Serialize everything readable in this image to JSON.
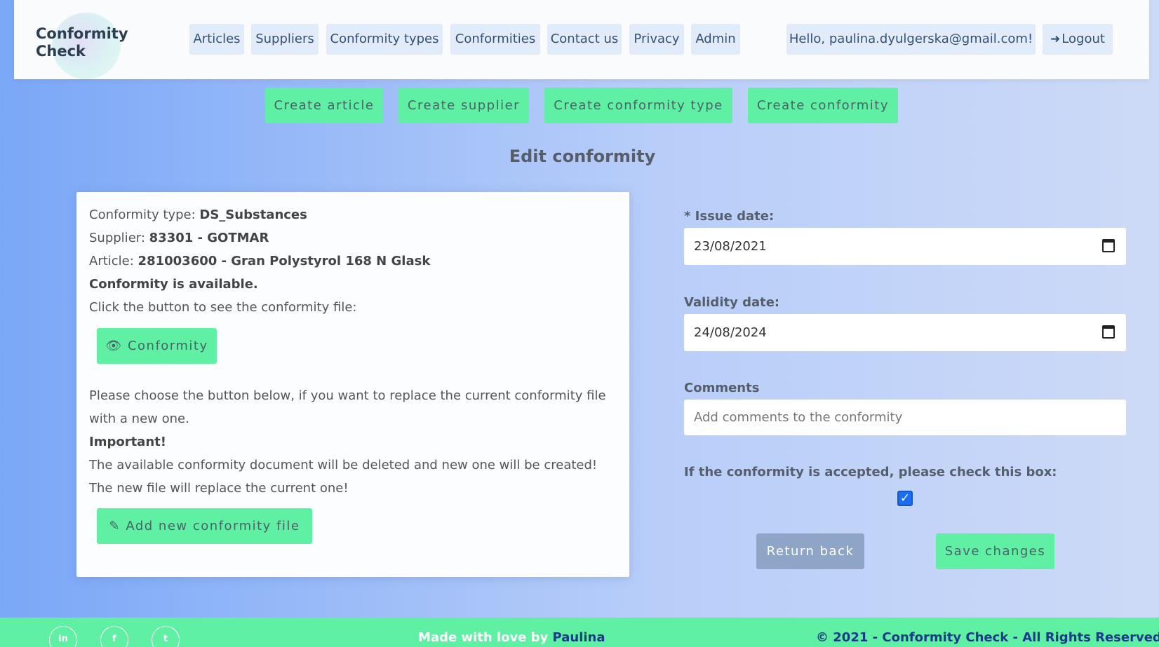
{
  "header": {
    "logo_line1": "Conformity",
    "logo_line2": "Check",
    "nav": [
      "Articles",
      "Suppliers",
      "Conformity types",
      "Conformities",
      "Contact us",
      "Privacy",
      "Admin"
    ],
    "greeting": "Hello, paulina.dyulgerska@gmail.com!",
    "logout_label": "Logout"
  },
  "create_buttons": [
    "Create article",
    "Create supplier",
    "Create conformity type",
    "Create conformity"
  ],
  "page_title": "Edit conformity",
  "card": {
    "type_label": "Conformity type:",
    "type_value": "DS_Substances",
    "supplier_label": "Supplier:",
    "supplier_value": "83301 - GOTMAR",
    "article_label": "Article:",
    "article_value": "281003600 - Gran Polystyrol 168 N Glask",
    "available_text": "Conformity is available.",
    "click_text": "Click the button to see the conformity file:",
    "conformity_button": "Conformity",
    "replace_text_1": "Please choose the button below, if you want to replace the current conformity file",
    "replace_text_2": "with a new one.",
    "important_label": "Important!",
    "warning_1": "The available conformity document will be deleted and new one will be created!",
    "warning_2": "The new file will replace the current one!",
    "add_file_button": "Add new conformity file"
  },
  "form": {
    "issue_label": "* Issue date:",
    "issue_value": "23/08/2021",
    "validity_label": "Validity date:",
    "validity_value": "24/08/2024",
    "comments_label": "Comments",
    "comments_placeholder": "Add comments to the conformity",
    "accepted_label": "If the conformity is accepted, please check this box:",
    "accepted_checked": true,
    "return_button": "Return back",
    "save_button": "Save changes"
  },
  "footer": {
    "social": [
      "in",
      "f",
      "t"
    ],
    "made_with_love": "Made with love by",
    "author": "Paulina",
    "copyright": "© 2021 - Conformity Check - All Rights Reserved"
  }
}
